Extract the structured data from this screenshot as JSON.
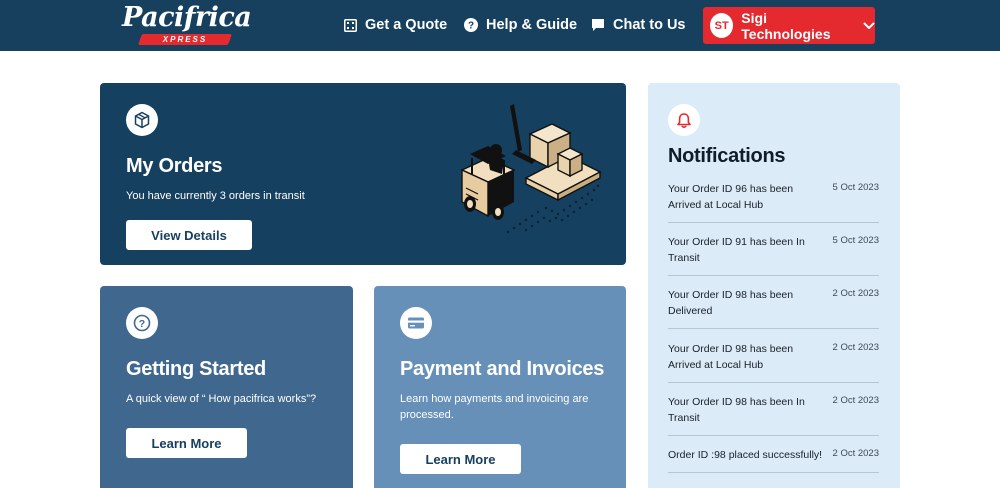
{
  "header": {
    "logo_text": "Pacifrica",
    "logo_sub": "XPRESS",
    "nav": {
      "quote": "Get a Quote",
      "help": "Help & Guide",
      "chat": "Chat to Us"
    },
    "account": {
      "initials": "ST",
      "name": "Sigi Technologies"
    }
  },
  "orders_card": {
    "title": "My Orders",
    "description": "You have currently 3 orders in transit",
    "button": "View Details"
  },
  "getting_started": {
    "title": "Getting Started",
    "description": "A quick view of “ How pacifrica works”?",
    "button": "Learn More"
  },
  "payments": {
    "title": "Payment and Invoices",
    "description": "Learn how payments and invoicing are processed.",
    "button": "Learn More"
  },
  "notifications": {
    "title": "Notifications",
    "items": [
      {
        "text": "Your Order ID 96 has been Arrived at Local Hub",
        "date": "5 Oct 2023"
      },
      {
        "text": "Your Order ID 91 has been In Transit",
        "date": "5 Oct 2023"
      },
      {
        "text": "Your Order ID 98 has been Delivered",
        "date": "2 Oct 2023"
      },
      {
        "text": "Your Order ID 98 has been Arrived at Local Hub",
        "date": "2 Oct 2023"
      },
      {
        "text": "Your Order ID 98 has been In Transit",
        "date": "2 Oct 2023"
      },
      {
        "text": "Order ID :98 placed successfully!",
        "date": "2 Oct 2023"
      }
    ]
  },
  "colors": {
    "navy": "#17405f",
    "brand_red": "#e52a2f",
    "card_mid": "#40688f",
    "card_light": "#6690b8",
    "notif_bg": "#dcebf8"
  },
  "icons": {
    "quote": "calculator-icon",
    "help": "question-circle-icon",
    "chat": "chat-bubble-icon",
    "chevron": "chevron-down-icon",
    "orders": "box-icon",
    "start": "question-icon",
    "payment": "credit-card-icon",
    "notifications": "bell-icon"
  }
}
